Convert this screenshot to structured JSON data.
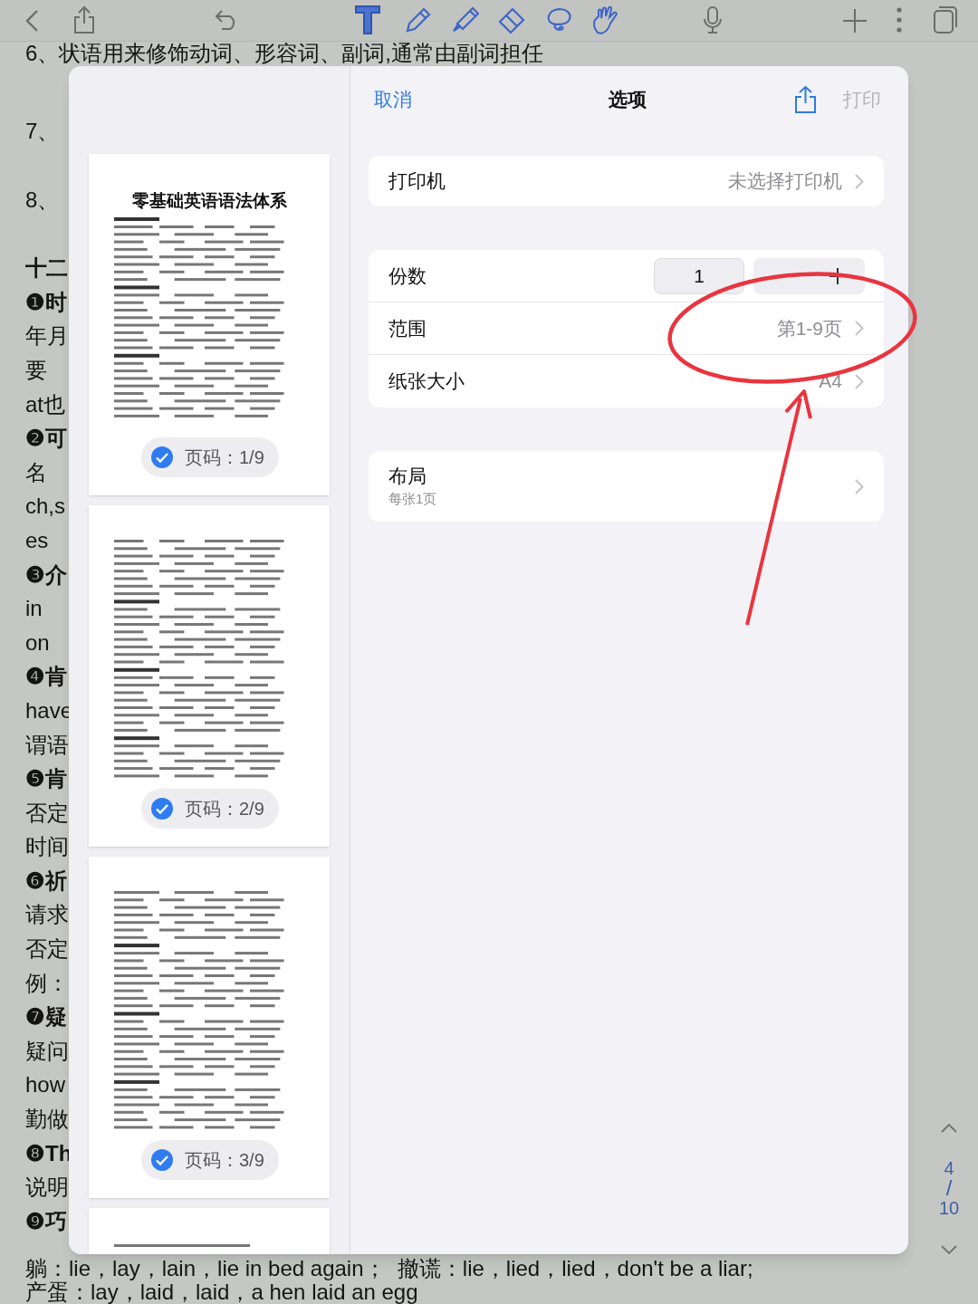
{
  "document_lines": [
    {
      "text": "6、状语用来修饰动词、形容词、副词,通常由副词担任",
      "kind": "numbered"
    },
    {
      "text": "7、",
      "kind": "numbered"
    },
    {
      "text": "8、",
      "kind": "numbered"
    },
    {
      "text": "十二",
      "kind": "heading"
    },
    {
      "text": "❶时",
      "kind": "bold"
    },
    {
      "text": "年月",
      "kind": "text"
    },
    {
      "text": "要",
      "kind": "text"
    },
    {
      "text": "at也",
      "kind": "text"
    },
    {
      "text": "❷可",
      "kind": "bold"
    },
    {
      "text": "名",
      "kind": "text"
    },
    {
      "text": "ch,s",
      "kind": "text"
    },
    {
      "text": "es",
      "kind": "text"
    },
    {
      "text": "❸介",
      "kind": "bold"
    },
    {
      "text": "in",
      "kind": "text"
    },
    {
      "text": "on",
      "kind": "text"
    },
    {
      "text": "❹肯",
      "kind": "bold"
    },
    {
      "text": "have",
      "kind": "text"
    },
    {
      "text": "谓语",
      "kind": "text"
    },
    {
      "text": "❺肯",
      "kind": "bold"
    },
    {
      "text": "否定",
      "kind": "text"
    },
    {
      "text": "时间",
      "kind": "text"
    },
    {
      "text": "❻祈",
      "kind": "bold"
    },
    {
      "text": "请求",
      "kind": "text"
    },
    {
      "text": "否定",
      "kind": "text"
    },
    {
      "text": "例：",
      "kind": "text"
    },
    {
      "text": "❼疑",
      "kind": "bold"
    },
    {
      "text": "疑问",
      "kind": "text"
    },
    {
      "text": "how",
      "kind": "text"
    },
    {
      "text": "勤做",
      "kind": "text"
    },
    {
      "text": "❽Th",
      "kind": "bold"
    },
    {
      "text": "说明",
      "kind": "text"
    },
    {
      "text": "❾巧",
      "kind": "bold"
    }
  ],
  "document_lines_below": [
    {
      "text": "躺：lie，lay，lain，lie in bed again；  撤谎：lie，lied，lied，don't be a liar;"
    },
    {
      "text": "产蛋：lay，laid，laid，a hen laid an egg"
    }
  ],
  "page_navigator": {
    "current": "4",
    "separator": "/",
    "total": "10"
  },
  "print_dialog": {
    "header": {
      "cancel": "取消",
      "title": "选项",
      "print": "打印"
    },
    "pages": [
      {
        "title": "零基础英语语法体系",
        "page_label": "页码：1/9",
        "selected": true,
        "kind": "full"
      },
      {
        "page_label": "页码：2/9",
        "selected": true,
        "kind": "full"
      },
      {
        "page_label": "页码：3/9",
        "selected": true,
        "kind": "full"
      },
      {
        "kind": "partial"
      }
    ],
    "printer": {
      "label": "打印机",
      "value": "未选择打印机"
    },
    "copies": {
      "label": "份数",
      "value": "1"
    },
    "range": {
      "label": "范围",
      "value": "第1-9页"
    },
    "paper_size": {
      "label": "纸张大小",
      "value": "A4"
    },
    "layout": {
      "label": "布局",
      "detail": "每张1页"
    }
  }
}
